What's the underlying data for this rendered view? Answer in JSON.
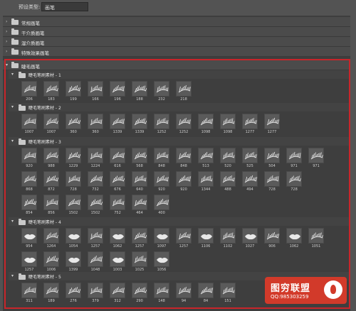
{
  "toolbar": {
    "preset_type_label": "预设类型:",
    "preset_type_value": "画笔"
  },
  "groups": [
    {
      "name": "常规画笔"
    },
    {
      "name": "干介质画笔"
    },
    {
      "name": "湿介质画笔"
    },
    {
      "name": "特殊效果画笔"
    },
    {
      "name": "睫毛画笔"
    }
  ],
  "subgroups": [
    {
      "name": "睫毛笔刷素材 - 1",
      "rows": [
        [
          "206",
          "183",
          "199",
          "166",
          "196",
          "188",
          "232",
          "218"
        ]
      ]
    },
    {
      "name": "睫毛笔刷素材 - 2",
      "rows": [
        [
          "1007",
          "1007",
          "360",
          "360",
          "1339",
          "1339",
          "1252",
          "1252",
          "1098",
          "1098",
          "1277",
          "1277"
        ]
      ]
    },
    {
      "name": "睫毛笔刷素材 - 3",
      "rows": [
        [
          "920",
          "988",
          "1229",
          "1224",
          "616",
          "568",
          "848",
          "848",
          "513",
          "520",
          "525",
          "504",
          "971",
          "971"
        ],
        [
          "868",
          "872",
          "728",
          "732",
          "676",
          "640",
          "920",
          "920",
          "1344",
          "488",
          "494",
          "728",
          "728"
        ],
        [
          "854",
          "856",
          "1502",
          "1502",
          "752",
          "464",
          "400"
        ]
      ]
    },
    {
      "name": "睫毛笔刷素材 - 4",
      "rows": [
        [
          "954",
          "1264",
          "1054",
          "1257",
          "1062",
          "1257",
          "1097",
          "1257",
          "1106",
          "1102",
          "1027",
          "906",
          "1062",
          "1051"
        ],
        [
          "1257",
          "1006",
          "1399",
          "1048",
          "1003",
          "1025",
          "1056"
        ]
      ]
    },
    {
      "name": "睫毛笔刷素材 - 5",
      "rows": [
        [
          "311",
          "189",
          "276",
          "379",
          "312",
          "290",
          "148",
          "94",
          "84",
          "151"
        ]
      ]
    }
  ],
  "watermark": {
    "brand": "图穷联盟",
    "qq": "QQ:985303259"
  }
}
